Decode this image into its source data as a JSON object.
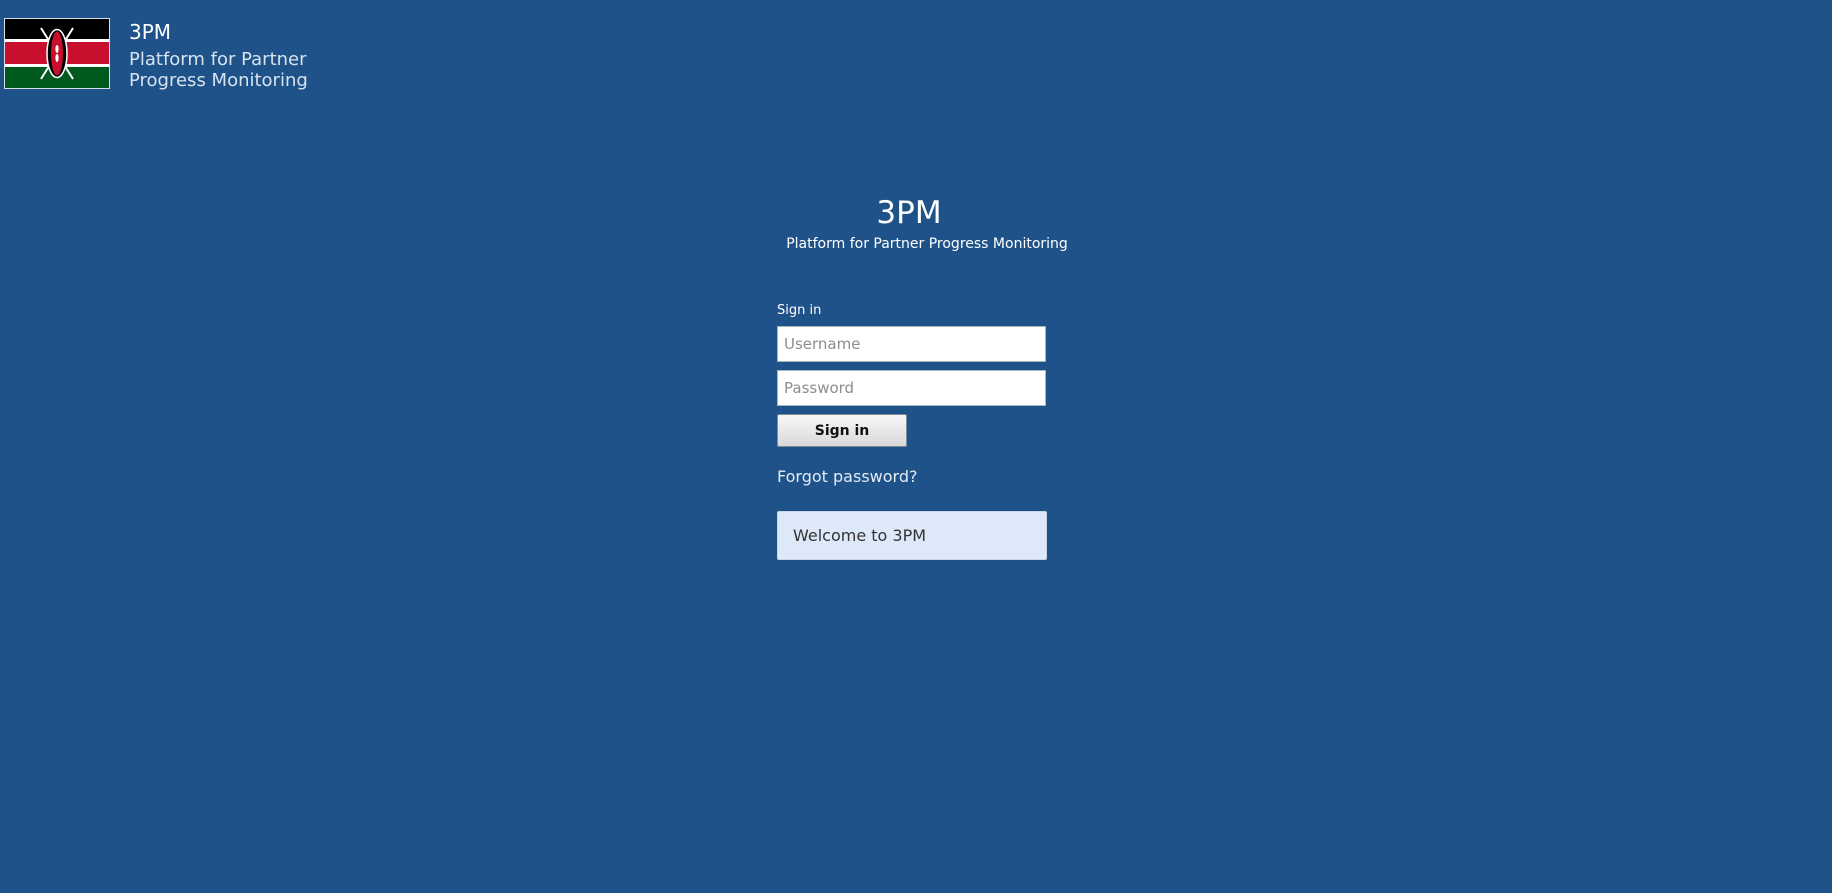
{
  "header": {
    "title": "3PM",
    "subtitle": "Platform for Partner Progress Monitoring",
    "flag_icon": "kenya-flag-icon"
  },
  "brand": {
    "title": "3PM",
    "subtitle": "Platform for Partner Progress Monitoring"
  },
  "login": {
    "heading": "Sign in",
    "username_placeholder": "Username",
    "password_placeholder": "Password",
    "submit_label": "Sign in",
    "forgot_label": "Forgot password?"
  },
  "message": {
    "text": "Welcome to 3PM"
  },
  "colors": {
    "background": "#1e5289",
    "message_box": "#dde9f8",
    "flag_black": "#000000",
    "flag_red": "#c8102e",
    "flag_green": "#005a1e"
  }
}
